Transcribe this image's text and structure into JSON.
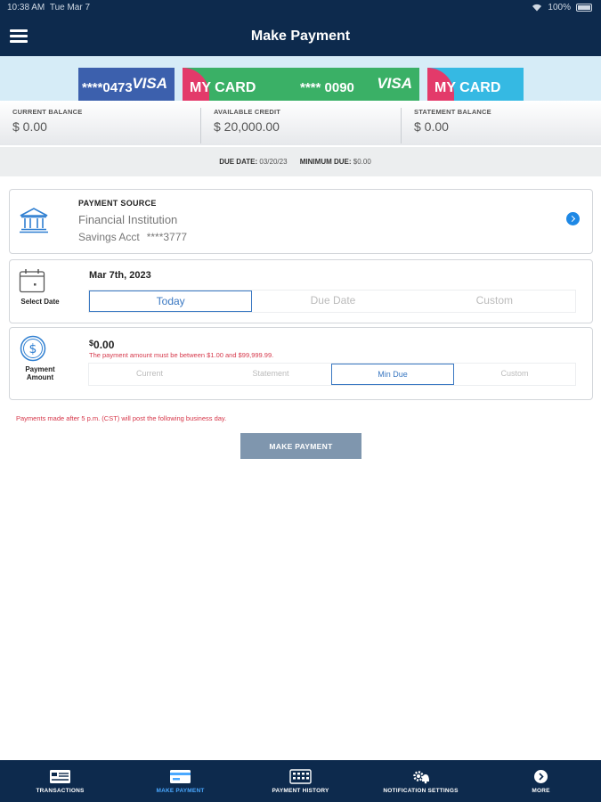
{
  "status_bar": {
    "time": "10:38 AM",
    "date": "Tue Mar 7",
    "battery": "100%"
  },
  "header": {
    "title": "Make Payment"
  },
  "cards": [
    {
      "name": "",
      "number": "****0473",
      "brand": "VISA"
    },
    {
      "name": "MY CARD",
      "number": "**** 0090",
      "brand": "VISA"
    },
    {
      "name": "MY CARD",
      "number": "",
      "brand": ""
    }
  ],
  "balances": [
    {
      "label": "CURRENT BALANCE",
      "value": "$ 0.00"
    },
    {
      "label": "AVAILABLE CREDIT",
      "value": "$ 20,000.00"
    },
    {
      "label": "STATEMENT BALANCE",
      "value": "$ 0.00"
    }
  ],
  "due": {
    "due_date_label": "DUE DATE:",
    "due_date": "03/20/23",
    "min_due_label": "MINIMUM DUE:",
    "min_due": "$0.00"
  },
  "payment_source": {
    "title": "PAYMENT SOURCE",
    "institution": "Financial Institution",
    "account_type": "Savings Acct",
    "account_number": "****3777",
    "icon": "bank-icon"
  },
  "select_date": {
    "label": "Select Date",
    "value": "Mar 7th, 2023",
    "options": [
      "Today",
      "Due Date",
      "Custom"
    ],
    "selected": "Today",
    "icon": "calendar-icon"
  },
  "payment_amount": {
    "label_line1": "Payment",
    "label_line2": "Amount",
    "currency": "$",
    "value": "0.00",
    "error": "The payment amount must be between $1.00 and $99,999.99.",
    "options": [
      "Current",
      "Statement",
      "Min Due",
      "Custom"
    ],
    "selected": "Min Due",
    "icon": "dollar-circle-icon"
  },
  "notice": "Payments made after 5 p.m. (CST) will post the following business day.",
  "make_payment_button": "MAKE PAYMENT",
  "tabs": [
    {
      "label": "TRANSACTIONS",
      "icon": "transactions-icon"
    },
    {
      "label": "MAKE PAYMENT",
      "icon": "card-icon"
    },
    {
      "label": "PAYMENT HISTORY",
      "icon": "calculator-icon"
    },
    {
      "label": "NOTIFICATION SETTINGS",
      "icon": "gear-bell-icon"
    },
    {
      "label": "MORE",
      "icon": "more-icon"
    }
  ],
  "active_tab": "MAKE PAYMENT",
  "colors": {
    "nav_bg": "#0d2a4d",
    "accent_blue": "#3a78c2",
    "error_red": "#d6374a",
    "button_gray": "#7f96ae",
    "active_tab": "#4aa8ff"
  }
}
